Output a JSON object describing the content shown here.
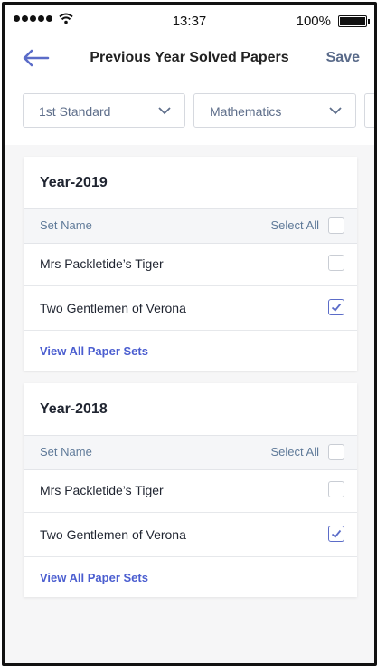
{
  "status_bar": {
    "time": "13:37",
    "battery": "100%"
  },
  "header": {
    "title": "Previous Year Solved Papers",
    "save_label": "Save",
    "back_icon": "arrow-left-icon",
    "accent": "#5b6cc8"
  },
  "filters": [
    {
      "label": "1st Standard"
    },
    {
      "label": "Mathematics"
    },
    {
      "label": ""
    }
  ],
  "cards": [
    {
      "year": "Year-2019",
      "col_set_name": "Set Name",
      "col_select_all": "Select All",
      "select_all_checked": false,
      "rows": [
        {
          "label": "Mrs Packletide’s Tiger",
          "checked": false
        },
        {
          "label": "Two Gentlemen of Verona",
          "checked": true
        }
      ],
      "view_all": "View All Paper Sets"
    },
    {
      "year": "Year-2018",
      "col_set_name": "Set Name",
      "col_select_all": "Select All",
      "select_all_checked": false,
      "rows": [
        {
          "label": "Mrs Packletide’s Tiger",
          "checked": false
        },
        {
          "label": "Two Gentlemen of Verona",
          "checked": true
        }
      ],
      "view_all": "View All Paper Sets"
    }
  ]
}
